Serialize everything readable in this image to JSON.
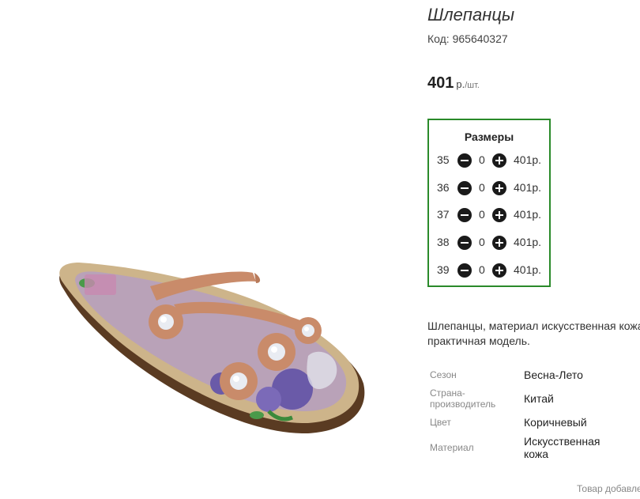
{
  "product": {
    "title": "Шлепанцы",
    "code_label": "Код: 965640327",
    "price_value": "401",
    "price_currency": "р.",
    "price_unit": "/шт."
  },
  "sizes": {
    "title": "Размеры",
    "rows": [
      {
        "size": "35",
        "qty": "0",
        "price": "401р."
      },
      {
        "size": "36",
        "qty": "0",
        "price": "401р."
      },
      {
        "size": "37",
        "qty": "0",
        "price": "401р."
      },
      {
        "size": "38",
        "qty": "0",
        "price": "401р."
      },
      {
        "size": "39",
        "qty": "0",
        "price": "401р."
      }
    ]
  },
  "description": "Шлепанцы, материал искусственная кожа, и практичная модель.",
  "properties": [
    {
      "label": "Сезон",
      "value": "Весна-Лето"
    },
    {
      "label": "Страна-производитель",
      "value": "Китай"
    },
    {
      "label": "Цвет",
      "value": "Коричневый"
    },
    {
      "label": "Материал",
      "value": "Искусственная кожа"
    }
  ],
  "footer_note": "Товар добавле",
  "colors": {
    "sizes_border": "#2a8a2a",
    "button": "#1a1a1a"
  }
}
